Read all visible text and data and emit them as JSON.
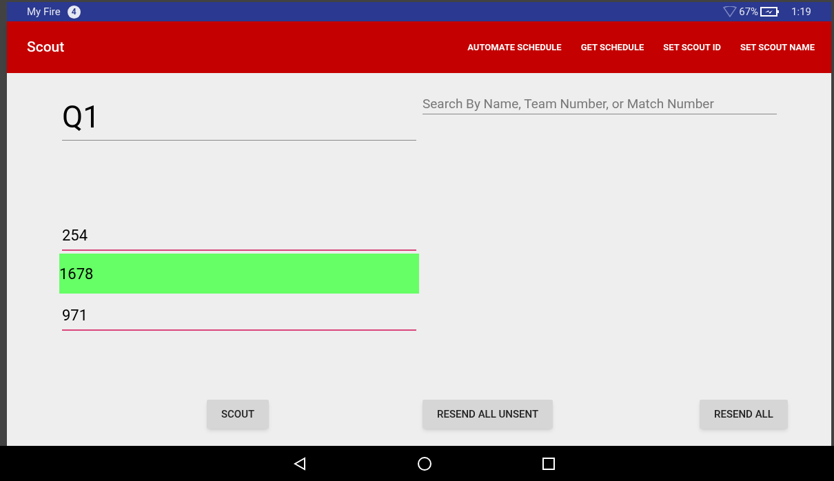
{
  "status_bar": {
    "title": "My Fire",
    "notification_count": "4",
    "battery": "67%",
    "time": "1:19"
  },
  "toolbar": {
    "title": "Scout",
    "actions": [
      "AUTOMATE SCHEDULE",
      "GET SCHEDULE",
      "SET SCOUT ID",
      "SET SCOUT NAME"
    ]
  },
  "match_field": {
    "value": "Q1"
  },
  "search": {
    "placeholder": "Search By Name, Team Number, or Match Number"
  },
  "teams": [
    {
      "value": "254",
      "selected": false
    },
    {
      "value": "1678",
      "selected": true
    },
    {
      "value": "971",
      "selected": false
    }
  ],
  "buttons": [
    "SCOUT",
    "RESEND ALL UNSENT",
    "RESEND ALL"
  ]
}
